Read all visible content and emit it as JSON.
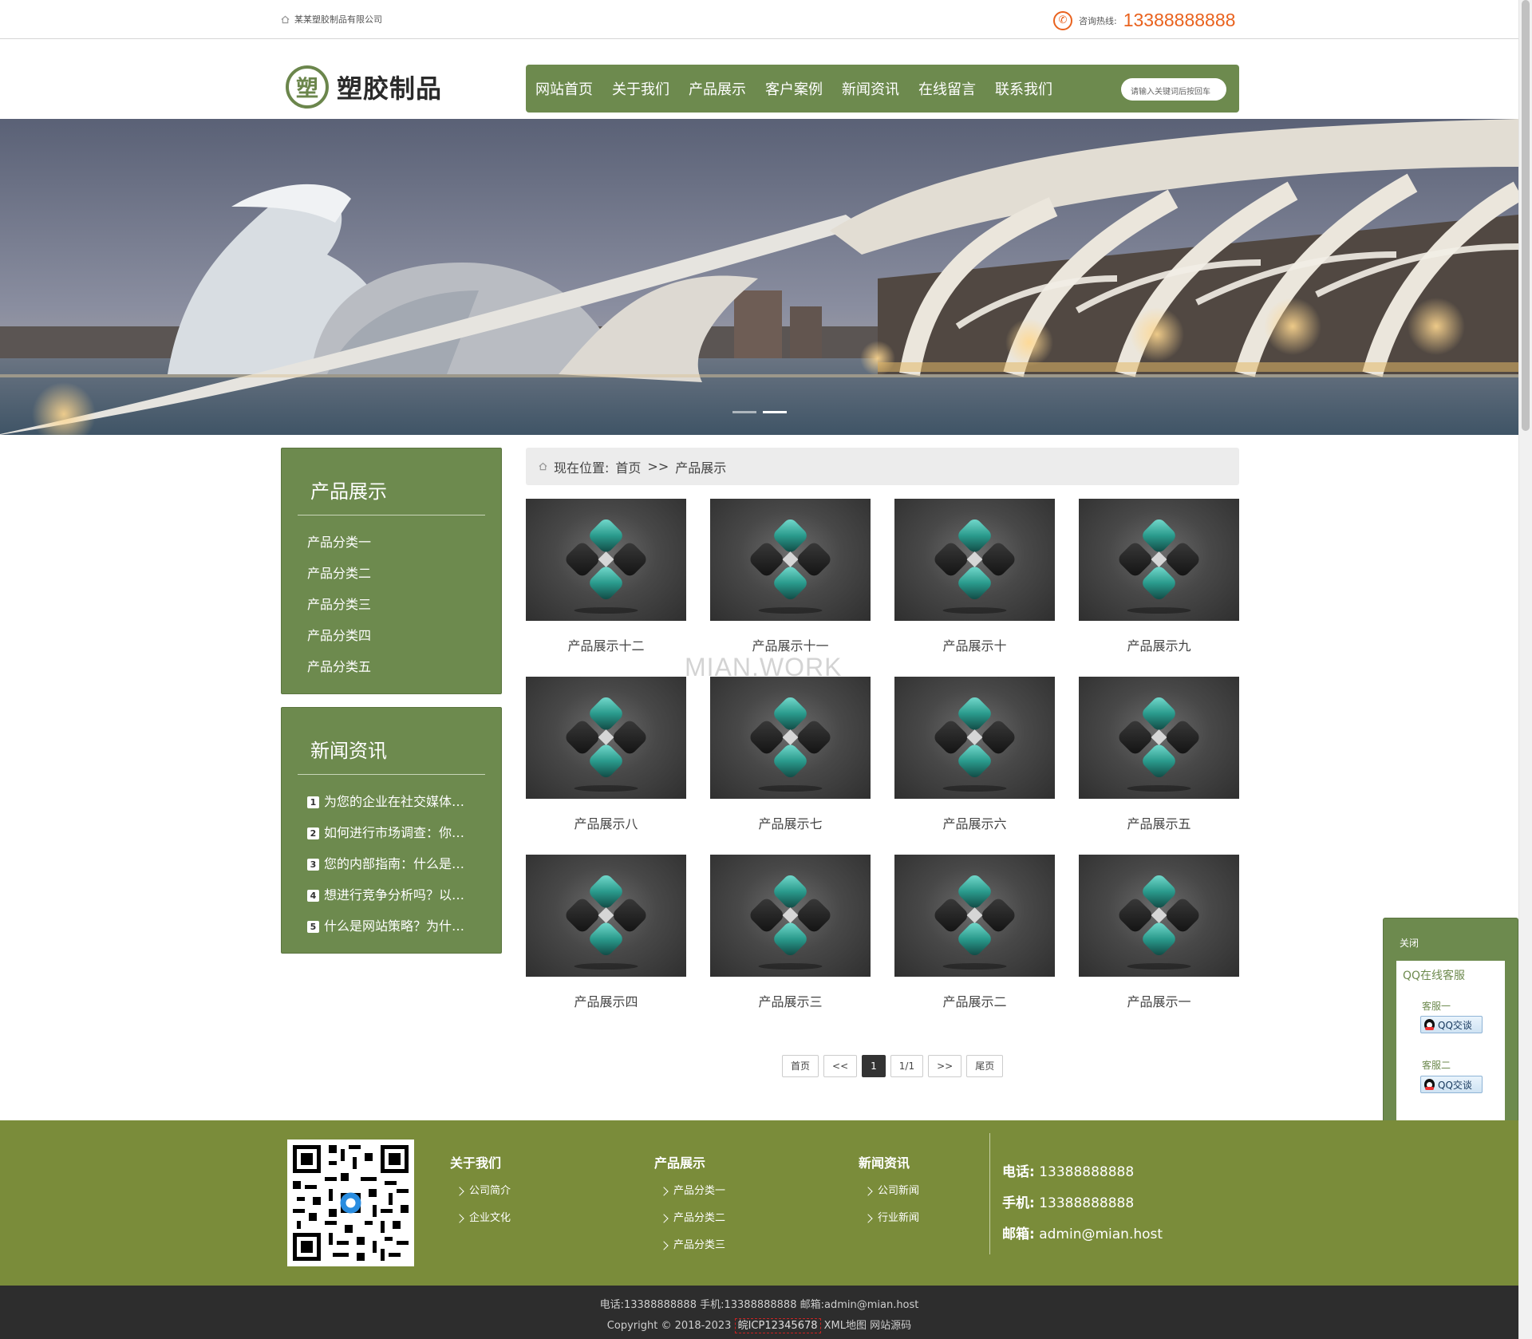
{
  "topbar": {
    "company": "某某塑胶制品有限公司",
    "hotline_label": "咨询热线:",
    "hotline_number": "13388888888",
    "phone_icon": "phone-icon"
  },
  "logo": {
    "mark": "塑",
    "name": "塑胶制品"
  },
  "nav": {
    "items": [
      "网站首页",
      "关于我们",
      "产品展示",
      "客户案例",
      "新闻资讯",
      "在线留言",
      "联系我们"
    ],
    "search_placeholder": "请输入关键词后按回车"
  },
  "colors": {
    "brand_green": "#6d8a4e",
    "footer_green": "#7a8c3a",
    "accent_orange": "#e9621e",
    "footer_dark": "#2d2d2d"
  },
  "sidebar": {
    "products": {
      "title": "产品展示",
      "items": [
        "产品分类一",
        "产品分类二",
        "产品分类三",
        "产品分类四",
        "产品分类五"
      ]
    },
    "news": {
      "title": "新闻资讯",
      "items": [
        {
          "n": "1",
          "text": "为您的企业在社交媒体…"
        },
        {
          "n": "2",
          "text": "如何进行市场调查：你…"
        },
        {
          "n": "3",
          "text": "您的内部指南：什么是…"
        },
        {
          "n": "4",
          "text": "想进行竞争分析吗？以…"
        },
        {
          "n": "5",
          "text": "什么是网站策略？为什…"
        }
      ]
    }
  },
  "breadcrumb": {
    "label": "现在位置:",
    "home": "首页",
    "sep": ">>",
    "current": "产品展示"
  },
  "products": [
    "产品展示十二",
    "产品展示十一",
    "产品展示十",
    "产品展示九",
    "产品展示八",
    "产品展示七",
    "产品展示六",
    "产品展示五",
    "产品展示四",
    "产品展示三",
    "产品展示二",
    "产品展示一"
  ],
  "watermark": "MIAN.WORK",
  "pager": {
    "first": "首页",
    "prev": "<<",
    "current": "1",
    "total": "1/1",
    "next": ">>",
    "last": "尾页"
  },
  "qq_panel": {
    "close": "关闭",
    "title": "QQ在线客服",
    "services": [
      {
        "name": "客服一",
        "button": "QQ交谈"
      },
      {
        "name": "客服二",
        "button": "QQ交谈"
      }
    ]
  },
  "footer": {
    "columns": [
      {
        "title": "关于我们",
        "links": [
          "公司简介",
          "企业文化"
        ]
      },
      {
        "title": "产品展示",
        "links": [
          "产品分类一",
          "产品分类二",
          "产品分类三"
        ]
      },
      {
        "title": "新闻资讯",
        "links": [
          "公司新闻",
          "行业新闻"
        ]
      }
    ],
    "contact": [
      {
        "label": "电话:",
        "value": "13388888888"
      },
      {
        "label": "手机:",
        "value": "13388888888"
      },
      {
        "label": "邮箱:",
        "value": "admin@mian.host"
      }
    ]
  },
  "bottom": {
    "line1": "电话:13388888888  手机:13388888888  邮箱:admin@mian.host",
    "copyright": "Copyright © 2018-2023",
    "icp": "皖ICP12345678",
    "xml": "XML地图",
    "source": "网站源码"
  }
}
